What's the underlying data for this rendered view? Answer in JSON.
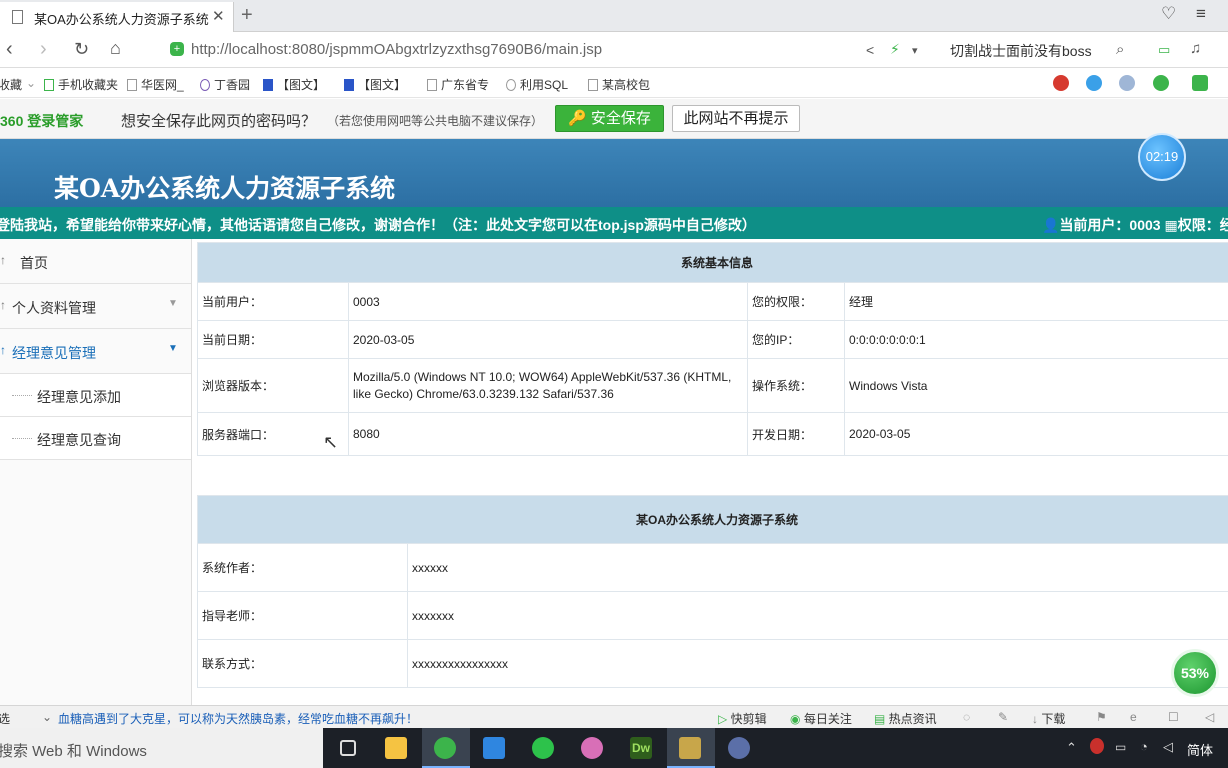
{
  "browser": {
    "tab_title": "某OA办公系统人力资源子系统",
    "url": "http://localhost:8080/jspmmOAbgxtrlzyzxthsg7690B6/main.jsp",
    "search_hint": "切割战士面前没有boss"
  },
  "bookmarks": [
    "收藏",
    "手机收藏夹",
    "华医网_",
    "丁香园",
    "【图文】",
    "【图文】",
    "广东省专",
    "利用SQL",
    "某高校包"
  ],
  "password_bar": {
    "brand": "360 登录管家",
    "question": "想安全保存此网页的密码吗？",
    "note": "（若您使用网吧等公共电脑不建议保存）",
    "save_label": "安全保存",
    "never_label": "此网站不再提示"
  },
  "header": {
    "title": "某OA办公系统人力资源子系统",
    "clock": "02:19",
    "marquee": "登陆我站，希望能给你带来好心情，其他话语请您自己修改，谢谢合作！（注：此处文字您可以在top.jsp源码中自己修改）",
    "current_user": "当前用户：0003",
    "permission": "权限：经"
  },
  "sidebar": {
    "home": "首页",
    "profile": "个人资料管理",
    "manager_opinion": "经理意见管理",
    "sub_items": [
      "经理意见添加",
      "经理意见查询"
    ]
  },
  "sysinfo": {
    "heading": "系统基本信息",
    "rows": [
      {
        "k1": "当前用户：",
        "v1": "0003",
        "k2": "您的权限：",
        "v2": "经理"
      },
      {
        "k1": "当前日期：",
        "v1": "2020-03-05",
        "k2": "您的IP：",
        "v2": "0:0:0:0:0:0:0:1"
      },
      {
        "k1": "浏览器版本：",
        "v1": "Mozilla/5.0 (Windows NT 10.0; WOW64) AppleWebKit/537.36 (KHTML, like Gecko) Chrome/63.0.3239.132 Safari/537.36",
        "k2": "操作系统：",
        "v2": "Windows Vista"
      },
      {
        "k1": "服务器端口：",
        "v1": "8080",
        "k2": "开发日期：",
        "v2": "2020-03-05"
      }
    ]
  },
  "about": {
    "heading": "某OA办公系统人力资源子系统",
    "rows": [
      {
        "k": "系统作者：",
        "v": "xxxxxx"
      },
      {
        "k": "指导老师：",
        "v": "xxxxxxx"
      },
      {
        "k": "联系方式：",
        "v": "xxxxxxxxxxxxxxxx"
      }
    ]
  },
  "statusbar": {
    "left": "选",
    "news": "血糖高遇到了大克星，可以称为天然胰岛素，经常吃血糖不再飙升！",
    "items": [
      "快剪辑",
      "每日关注",
      "热点资讯",
      "下载"
    ],
    "gauge": "53%"
  },
  "taskbar": {
    "search": "搜索 Web 和 Windows",
    "lang": "简体"
  }
}
